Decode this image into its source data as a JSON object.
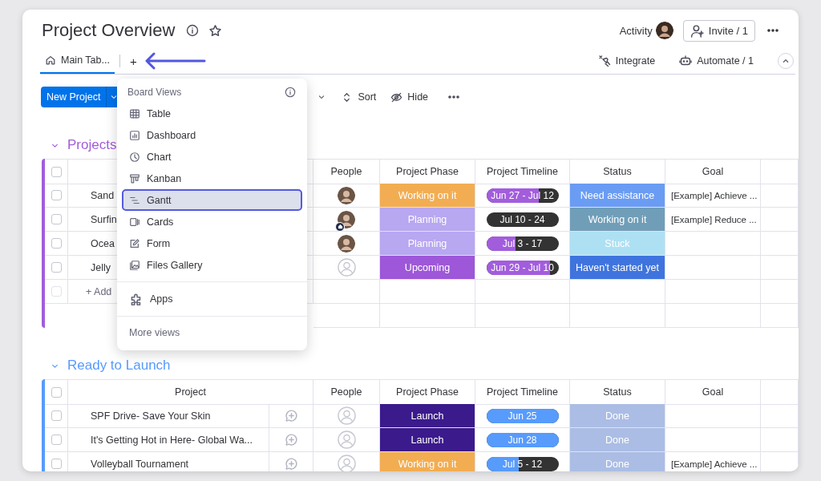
{
  "header": {
    "title": "Project Overview",
    "activity_label": "Activity",
    "invite_label": "Invite / 1"
  },
  "tabs": [
    {
      "label": "Main Tab...",
      "selected": true
    }
  ],
  "add_view_label": "+",
  "tab_actions": {
    "integrate_label": "Integrate",
    "automate_label": "Automate / 1"
  },
  "toolbar": {
    "new_button_label": "New Project",
    "sort_label": "Sort",
    "hide_label": "Hide"
  },
  "views_menu": {
    "title": "Board Views",
    "items": [
      {
        "kind": "table",
        "label": "Table",
        "selected": false
      },
      {
        "kind": "dashboard",
        "label": "Dashboard",
        "selected": false
      },
      {
        "kind": "chart",
        "label": "Chart",
        "selected": false
      },
      {
        "kind": "kanban",
        "label": "Kanban",
        "selected": false
      },
      {
        "kind": "gantt",
        "label": "Gantt",
        "selected": true
      },
      {
        "kind": "cards",
        "label": "Cards",
        "selected": false
      },
      {
        "kind": "form",
        "label": "Form",
        "selected": false
      },
      {
        "kind": "gallery",
        "label": "Files Gallery",
        "selected": false
      }
    ],
    "apps_label": "Apps",
    "more_label": "More views"
  },
  "groups": [
    {
      "title": "Projects",
      "color": "#a25ddc",
      "all_checked": false,
      "add_row": {
        "label": "+ Add",
        "checked": false
      },
      "columns": [
        "People",
        "Project Phase",
        "Project Timeline",
        "Status",
        "Goal"
      ],
      "rows": [
        {
          "checked": false,
          "name": "Sand",
          "person": {
            "kind": "photo"
          },
          "phase": {
            "text": "Working on it",
            "color": "#f2ad52"
          },
          "timeline": {
            "text": "Jun 27 - Jul 12",
            "level": 0.73
          },
          "status": {
            "text": "Need assistance",
            "color": "#6a9cf4"
          },
          "goal": "[Example] Achieve ..."
        },
        {
          "checked": false,
          "name": "Surfin",
          "person": {
            "kind": "photo_home"
          },
          "phase": {
            "text": "Planning",
            "color": "#b8a7f1"
          },
          "timeline": {
            "text": "Jul 10 - 24",
            "level": 0
          },
          "status": {
            "text": "Working on it",
            "color": "#709eb8"
          },
          "goal": "[Example] Reduce ..."
        },
        {
          "checked": false,
          "name": "Ocea",
          "person": {
            "kind": "photo"
          },
          "phase": {
            "text": "Planning",
            "color": "#b8a7f1"
          },
          "timeline": {
            "text": "Jul 3 - 17",
            "level": 0.4
          },
          "status": {
            "text": "Stuck",
            "color": "#aee0f3"
          }
        },
        {
          "checked": false,
          "name": "Jelly",
          "person": {
            "kind": "empty"
          },
          "phase": {
            "text": "Upcoming",
            "color": "#9d57d8"
          },
          "timeline": {
            "text": "Jun 29 - Jul 10",
            "level": 0.88
          },
          "status": {
            "text": "Haven't started yet",
            "color": "#3f74de"
          }
        }
      ]
    },
    {
      "title": "Ready to Launch",
      "color": "#579bfc",
      "all_checked": false,
      "name_column": "Project",
      "columns": [
        "People",
        "Project Phase",
        "Project Timeline",
        "Status",
        "Goal"
      ],
      "rows": [
        {
          "checked": false,
          "name": "SPF Drive- Save Your Skin",
          "person": {
            "kind": "empty"
          },
          "phase": {
            "text": "Launch",
            "color": "#3b1a8c"
          },
          "timeline": {
            "text": "Jun 25",
            "level": 1
          },
          "status": {
            "text": "Done",
            "color": "#abbde5"
          }
        },
        {
          "checked": false,
          "name": "It's Getting Hot in Here- Global Wa...",
          "person": {
            "kind": "empty"
          },
          "phase": {
            "text": "Launch",
            "color": "#3b1a8c"
          },
          "timeline": {
            "text": "Jun 28",
            "level": 1
          },
          "status": {
            "text": "Done",
            "color": "#abbde5"
          }
        },
        {
          "checked": false,
          "name": "Volleyball Tournament",
          "person": {
            "kind": "empty"
          },
          "phase": {
            "text": "Working on it",
            "color": "#f2ad52"
          },
          "timeline": {
            "text": "Jul 5 - 12",
            "level": 0.45
          },
          "status": {
            "text": "Done",
            "color": "#abbde5"
          },
          "goal": "[Example] Achieve ..."
        }
      ]
    }
  ]
}
